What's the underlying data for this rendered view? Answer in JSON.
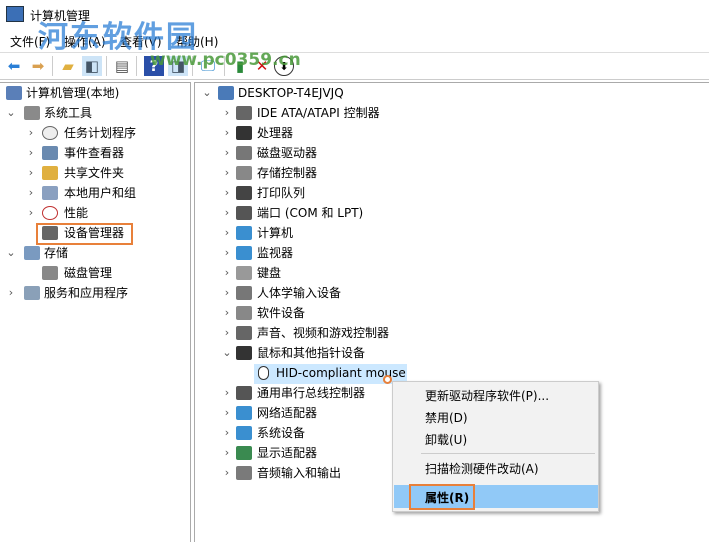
{
  "window": {
    "title": "计算机管理",
    "watermark": "河东软件园",
    "watermark_url": "www.pc0359.cn"
  },
  "menu": [
    "文件(F)",
    "操作(A)",
    "查看(V)",
    "帮助(H)"
  ],
  "toolbar": [
    "back-icon",
    "forward-icon",
    "up-folder-icon",
    "show-hide-tree-icon",
    "properties-icon",
    "help-icon",
    "action-pane-icon",
    "monitor-icon",
    "update-driver-icon",
    "uninstall-icon",
    "disable-icon"
  ],
  "left_tree": {
    "root": "计算机管理(本地)",
    "system_tools": "系统工具",
    "items": [
      "任务计划程序",
      "事件查看器",
      "共享文件夹",
      "本地用户和组",
      "性能",
      "设备管理器"
    ],
    "storage": "存储",
    "disk": "磁盘管理",
    "services": "服务和应用程序"
  },
  "right_tree": {
    "root": "DESKTOP-T4EJVJQ",
    "items": [
      "IDE ATA/ATAPI 控制器",
      "处理器",
      "磁盘驱动器",
      "存储控制器",
      "打印队列",
      "端口 (COM 和 LPT)",
      "计算机",
      "监视器",
      "键盘",
      "人体学输入设备",
      "软件设备",
      "声音、视频和游戏控制器",
      "鼠标和其他指针设备"
    ],
    "child": "HID-compliant mouse",
    "items2": [
      "通用串行总线控制器",
      "网络适配器",
      "系统设备",
      "显示适配器",
      "音频输入和输出"
    ]
  },
  "context_menu": {
    "update": "更新驱动程序软件(P)...",
    "disable": "禁用(D)",
    "uninstall": "卸载(U)",
    "scan": "扫描检测硬件改动(A)",
    "properties": "属性(R)"
  }
}
